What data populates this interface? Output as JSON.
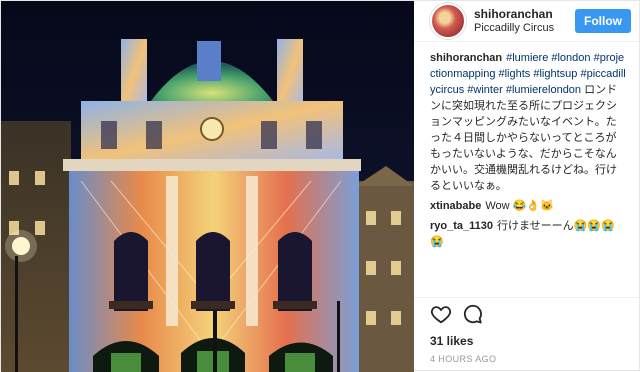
{
  "post": {
    "username": "shihoranchan",
    "location": "Piccadilly Circus",
    "follow_label": "Follow",
    "caption": {
      "user": "shihoranchan",
      "hashtags": [
        "#lumiere",
        "#london",
        "#projectionmapping",
        "#lights",
        "#lightsup",
        "#piccadillycircus",
        "#winter",
        "#lumierelondon"
      ],
      "text": "ロンドンに突如現れた至る所にプロジェクションマッピングみたいなイベント。たった４日間しかやらないってところがもったいないような、だからこそなんかいい。交通機関乱れるけどね。行けるといいなぁ。"
    },
    "comments": [
      {
        "user": "xtinababe",
        "text": "Wow 😂👌🐱"
      },
      {
        "user": "ryo_ta_1130",
        "text": "行けませーーん😭😭😭😭"
      }
    ],
    "likes": "31 likes",
    "timestamp": "4 HOURS AGO",
    "icons": {
      "like": "heart-icon",
      "comment": "comment-icon"
    }
  },
  "colors": {
    "accent": "#3897f0",
    "hashtag": "#003569",
    "text": "#262626",
    "muted": "#999999"
  }
}
